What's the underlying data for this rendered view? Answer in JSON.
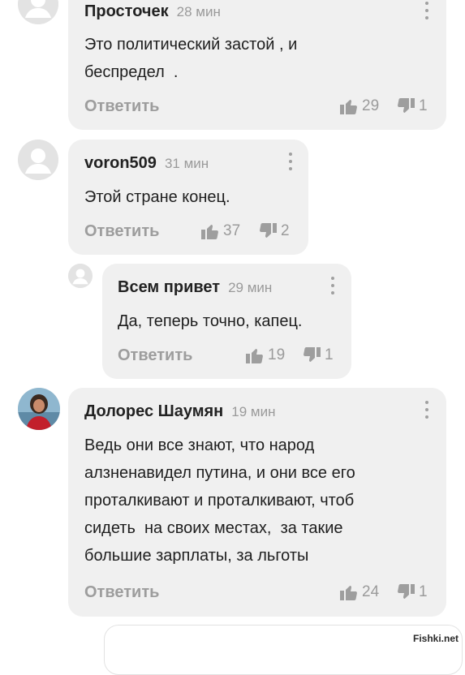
{
  "comments": [
    {
      "name": "Просточек",
      "time": "28 мин",
      "lines": [
        "Это политический застой , и",
        "беспредел  ."
      ],
      "reply_label": "Ответить",
      "likes": "29",
      "dislikes": "1",
      "avatar_icon": "default-user-icon"
    },
    {
      "name": "voron509",
      "time": "31 мин",
      "lines": [
        "Этой стране конец."
      ],
      "reply_label": "Ответить",
      "likes": "37",
      "dislikes": "2",
      "avatar_icon": "default-user-icon"
    },
    {
      "name": "Всем привет",
      "time": "29 мин",
      "lines": [
        "Да, теперь точно, капец."
      ],
      "reply_label": "Ответить",
      "likes": "19",
      "dislikes": "1",
      "avatar_icon": "default-user-icon"
    },
    {
      "name": "Долорес Шаумян",
      "time": "19 мин",
      "lines": [
        "Ведь они все знают, что народ",
        "алзненавидел путина, и они все его",
        "проталкивают и проталкивают, чтоб",
        "сидеть  на своих местах,  за такие",
        "большие зарплаты, за льготы"
      ],
      "reply_label": "Ответить",
      "likes": "24",
      "dislikes": "1",
      "avatar_icon": "user-photo"
    }
  ],
  "watermark": "Fishki.net",
  "colors": {
    "bubble": "#f0f0f0",
    "muted_text": "#9d9d9d",
    "body_text": "#1e1e1e",
    "name_text": "#222222"
  }
}
